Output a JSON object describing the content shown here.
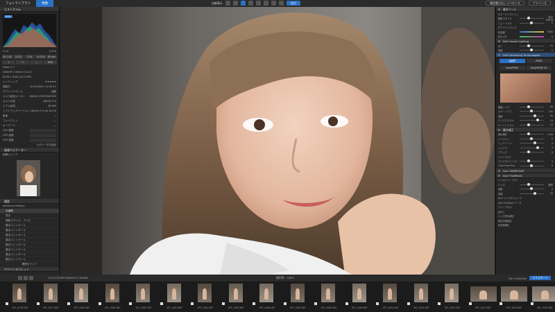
{
  "topbar": {
    "app_tab": "フォトライブラリ",
    "edit_tab": "現像",
    "mid_label": "比較表示",
    "export_label": "出力",
    "right_pill_1": "構造書き出しライセンス",
    "right_pill_2": "アドバンス"
  },
  "left_panel": {
    "histogram_title": "ヒストグラム",
    "histogram_mode": "RGB",
    "info_rows": [
      {
        "label": "F1.6",
        "value": "1/125"
      },
      {
        "label": "ISO 100",
        "value": "85.0 mm"
      }
    ],
    "buttons": [
      "ISO 100",
      "1/125",
      "F1.6",
      "+0.0 EV",
      "85 mm"
    ],
    "tools": [
      "1",
      "3",
      "—",
      "RAW"
    ],
    "camera": "Nikon Z 7",
    "lens": "NIKKOR Z 85mm f/1.8 S",
    "size": "8256 x 5504 (45.4 MP)",
    "meta_rows": [
      {
        "label": "レーティング",
        "value": "★★★★★"
      },
      {
        "label": "撮影日",
        "value": "2023/06/03 13:05:12"
      },
      {
        "label": "ホワイトバランス",
        "value": "自動"
      },
      {
        "label": "カメラ製造メーカー",
        "value": "NIKON CORPORATION"
      },
      {
        "label": "カメラの型",
        "value": "NIKON Z 6"
      },
      {
        "label": "ビデオ品質",
        "value": "非HDR"
      },
      {
        "label": "ソフトウェアバージョン",
        "value": "NIKON Z 6 Ver.03.00"
      },
      {
        "label": "著者",
        "value": "—"
      },
      {
        "label": "フォーマット",
        "value": "—"
      },
      {
        "label": "キーワード",
        "value": "—"
      }
    ],
    "gps_rows": [
      "GPS 緯度",
      "GPS 経度",
      "GPS 高度"
    ],
    "more_link": "メタデータを追加",
    "section_navigator": "画像ナビゲーター",
    "section_fit": "画像ビューア",
    "section_history": "履歴",
    "history_title": "Advanced History",
    "history_items": [
      "元画像",
      "表示",
      "撮影スタイル：プリセ",
      "露出コントロール",
      "露出コントロール",
      "露出コントロール",
      "露出コントロール",
      "露出コントロール",
      "露出コントロール",
      "露出コントロール",
      "露出コントロール"
    ],
    "history_footer": "履歴をクリア",
    "section_bottom": "アドバンスパレット"
  },
  "right_panel": {
    "section_basic": "基本ツール",
    "sub_color": "カラーレンディション",
    "rows_color": [
      {
        "label": "撮影スタイル",
        "value": "純正 NIKON"
      },
      {
        "label": "ニュートラル",
        "value": "0"
      }
    ],
    "sub_wb": "ホワイトバランス",
    "rows_wb": [
      {
        "label": "色温度",
        "value": "5000"
      },
      {
        "label": "色かぶり",
        "value": "0"
      }
    ],
    "section_smart": "DxO Smart Lighting",
    "rows_smart": [
      {
        "label": "均一",
        "value": "25"
      },
      {
        "label": "強度",
        "value": "0"
      }
    ],
    "section_denoise": "DxO Denoising Technologies",
    "denoise_modes": [
      "高品質",
      "PRIME",
      "DeepPRIME",
      "DeepPRIME XD"
    ],
    "rows_denoise": [
      {
        "label": "輝度ノイズ",
        "value": "40"
      },
      {
        "label": "カラーノイズ",
        "value": "100"
      },
      {
        "label": "強度",
        "value": "40"
      },
      {
        "label": "デッドピクセル",
        "value": "10"
      },
      {
        "label": "ルーミノシティ",
        "value": "10"
      }
    ],
    "section_exposure": "露光補正",
    "rows_exposure": [
      {
        "label": "露出補正",
        "value": "0.00"
      },
      {
        "label": "ハイライト",
        "value": "0"
      },
      {
        "label": "ミッドトーン",
        "value": "0"
      },
      {
        "label": "シャドウ",
        "value": "0"
      },
      {
        "label": "ブラック",
        "value": "0"
      }
    ],
    "sub_contrast": "コントラスト",
    "rows_contrast": [
      {
        "label": "マイクロコントラスト",
        "value": "0"
      },
      {
        "label": "ClearView Plus",
        "value": "0"
      }
    ],
    "section_viewpoint": "DxO VIEWPOINT",
    "section_filmpack": "DxO FILMPACK",
    "sub_lens": "レンズシャープネス",
    "rows_lens": [
      {
        "label": "レンズ",
        "value": "標準"
      },
      {
        "label": "強度",
        "value": "0"
      },
      {
        "label": "詳細",
        "value": "50"
      }
    ],
    "lens_name": "DxO レンズモジュール",
    "lens_footer": "DxO FilmPack テーマ",
    "tail_rows": [
      "シャープネス",
      "ぼかし",
      "レンズ歪み補正",
      "周辺光量補正",
      "色収差補正"
    ]
  },
  "bottombar": {
    "path": "D:\\2023\\0603\\NIKON Z 6\\RAW",
    "count": "選択数：1/867",
    "collection": "File Collection",
    "export_btn": "エクスポート"
  },
  "filmstrip": [
    {
      "name": "ZEF_4078.NEF",
      "land": false
    },
    {
      "name": "ZEF_4079.NEF",
      "land": false
    },
    {
      "name": "ZEF_4080.NEF",
      "land": false
    },
    {
      "name": "ZEF_4081.NEF",
      "land": false
    },
    {
      "name": "ZEF_4082.NEF",
      "land": false
    },
    {
      "name": "ZEF_4083.NEF",
      "land": false
    },
    {
      "name": "ZEF_4084.NEF",
      "land": false
    },
    {
      "name": "ZEF_4085.NEF",
      "land": false
    },
    {
      "name": "ZEF_4086.NEF",
      "land": false
    },
    {
      "name": "ZEF_4087.NEF",
      "land": false
    },
    {
      "name": "ZEF_4088.NEF",
      "land": false
    },
    {
      "name": "ZEF_4089.NEF",
      "land": false
    },
    {
      "name": "ZEF_4090.NEF",
      "land": false
    },
    {
      "name": "ZEF_4091.NEF",
      "land": false
    },
    {
      "name": "ZEF_4092.NEF",
      "land": false
    },
    {
      "name": "ZEF_4093.NEF",
      "land": true
    },
    {
      "name": "ZEF_4094.NEF",
      "land": true
    },
    {
      "name": "ZEF_4095.NEF",
      "land": true
    }
  ]
}
